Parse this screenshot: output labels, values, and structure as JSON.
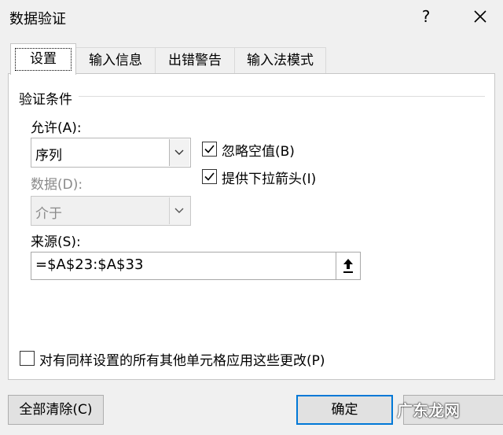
{
  "dialog": {
    "title": "数据验证",
    "help": "?"
  },
  "tabs": [
    {
      "label": "设置",
      "active": true
    },
    {
      "label": "输入信息",
      "active": false
    },
    {
      "label": "出错警告",
      "active": false
    },
    {
      "label": "输入法模式",
      "active": false
    }
  ],
  "settings": {
    "group_title": "验证条件",
    "allow_label": "允许(A):",
    "allow_value": "序列",
    "data_label": "数据(D):",
    "data_value": "介于",
    "ignore_blank_label": "忽略空值(B)",
    "ignore_blank_checked": true,
    "dropdown_label": "提供下拉箭头(I)",
    "dropdown_checked": true,
    "source_label": "来源(S):",
    "source_value": "=$A$23:$A$33",
    "apply_all_label": "对有同样设置的所有其他单元格应用这些更改(P)",
    "apply_all_checked": false
  },
  "buttons": {
    "clear_all": "全部清除(C)",
    "ok": "确定"
  },
  "watermark": "广东龙网"
}
